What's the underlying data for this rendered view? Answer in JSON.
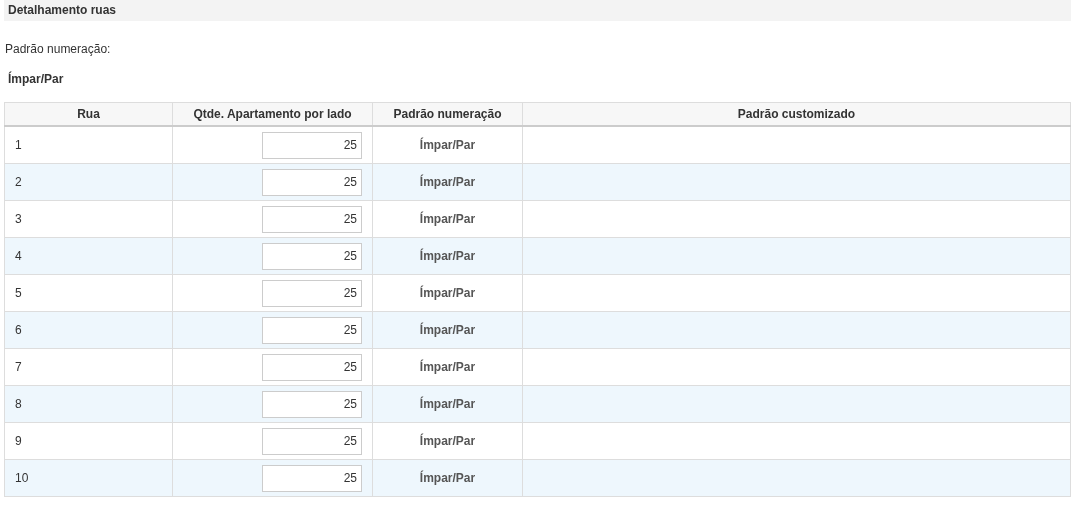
{
  "section": {
    "title": "Detalhamento ruas"
  },
  "numbering": {
    "label": "Padrão numeração:",
    "value": "Ímpar/Par"
  },
  "table": {
    "columns": [
      "Rua",
      "Qtde. Apartamento por lado",
      "Padrão numeração",
      "Padrão customizado"
    ],
    "rows": [
      {
        "street": "1",
        "quantity": "25",
        "pattern": "Ímpar/Par"
      },
      {
        "street": "2",
        "quantity": "25",
        "pattern": "Ímpar/Par"
      },
      {
        "street": "3",
        "quantity": "25",
        "pattern": "Ímpar/Par"
      },
      {
        "street": "4",
        "quantity": "25",
        "pattern": "Ímpar/Par"
      },
      {
        "street": "5",
        "quantity": "25",
        "pattern": "Ímpar/Par"
      },
      {
        "street": "6",
        "quantity": "25",
        "pattern": "Ímpar/Par"
      },
      {
        "street": "7",
        "quantity": "25",
        "pattern": "Ímpar/Par"
      },
      {
        "street": "8",
        "quantity": "25",
        "pattern": "Ímpar/Par"
      },
      {
        "street": "9",
        "quantity": "25",
        "pattern": "Ímpar/Par"
      },
      {
        "street": "10",
        "quantity": "25",
        "pattern": "Ímpar/Par"
      }
    ]
  }
}
